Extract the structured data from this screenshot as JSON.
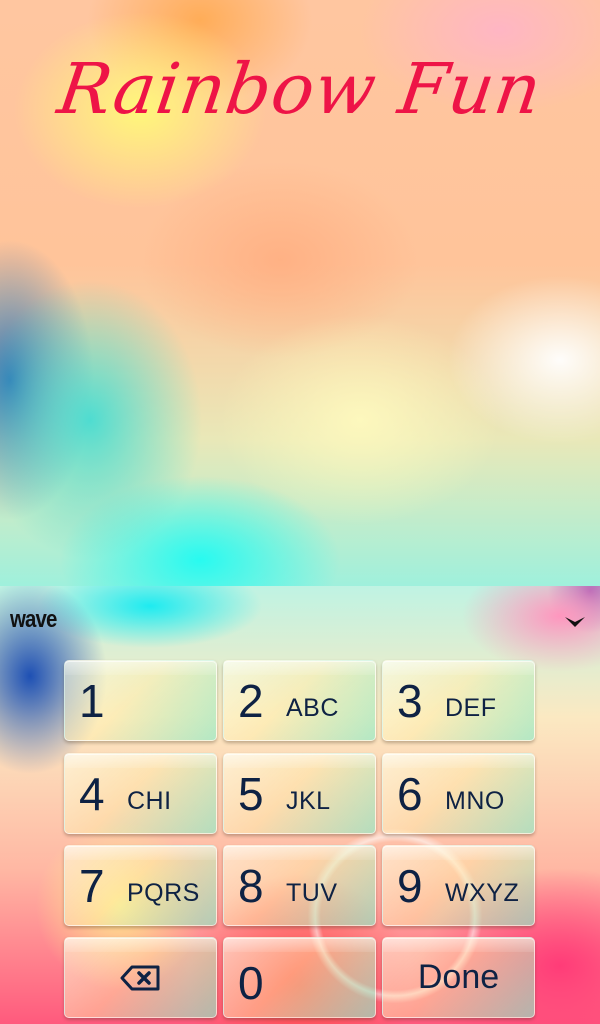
{
  "preview": {
    "title": "Rainbow Fun",
    "title_color": "#ee1447"
  },
  "keyboard": {
    "logo": "wave",
    "collapse_icon": "chevron-down-icon",
    "text_color": "#0e2244",
    "keys": [
      {
        "digit": "1",
        "letters": ""
      },
      {
        "digit": "2",
        "letters": "ABC"
      },
      {
        "digit": "3",
        "letters": "DEF"
      },
      {
        "digit": "4",
        "letters": "CHI"
      },
      {
        "digit": "5",
        "letters": "JKL"
      },
      {
        "digit": "6",
        "letters": "MNO"
      },
      {
        "digit": "7",
        "letters": "PQRS"
      },
      {
        "digit": "8",
        "letters": "TUV"
      },
      {
        "digit": "9",
        "letters": "WXYZ"
      }
    ],
    "backspace_icon": "backspace-icon",
    "zero": "0",
    "done_label": "Done"
  }
}
